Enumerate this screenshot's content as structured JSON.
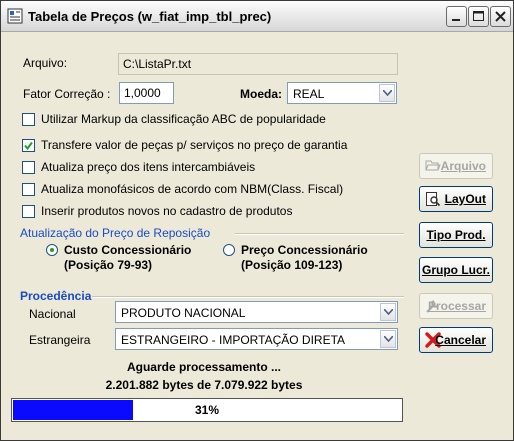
{
  "window": {
    "title": "Tabela de Preços (w_fiat_imp_tbl_prec)"
  },
  "form": {
    "arquivo_label": "Arquivo:",
    "arquivo_value": "C:\\ListaPr.txt",
    "fator_label": "Fator Correção :",
    "fator_value": "1,0000",
    "moeda_label": "Moeda:",
    "moeda_value": "REAL"
  },
  "options": [
    {
      "label": "Utilizar Markup da classificação ABC de popularidade",
      "checked": false
    },
    {
      "label": "Transfere valor de peças p/ serviços no preço de garantia",
      "checked": true
    },
    {
      "label": "Atualiza preço dos itens intercambiáveis",
      "checked": false
    },
    {
      "label": "Atualiza monofásicos de acordo com NBM(Class. Fiscal)",
      "checked": false
    },
    {
      "label": "Inserir produtos novos no cadastro de produtos",
      "checked": false
    }
  ],
  "reposicao": {
    "title": "Atualização do Preço de Reposição",
    "options": [
      {
        "label": "Custo Concessionário",
        "sub": "(Posição 79-93)",
        "selected": true
      },
      {
        "label": "Preço Concessionário",
        "sub": "(Posição 109-123)",
        "selected": false
      }
    ]
  },
  "procedencia": {
    "title": "Procedência",
    "nacional_label": "Nacional",
    "nacional_value": "PRODUTO NACIONAL",
    "estrangeira_label": "Estrangeira",
    "estrangeira_value": "ESTRANGEIRO - IMPORTAÇÃO DIRETA"
  },
  "buttons": {
    "arquivo": "Arquivo",
    "layout": "LayOut",
    "tipo_prod": "Tipo Prod.",
    "grupo_lucr": "Grupo Lucr.",
    "processar": "Processar",
    "cancelar": "Cancelar"
  },
  "status": {
    "message": "Aguarde processamento ...",
    "bytes": "2.201.882 bytes de 7.079.922 bytes",
    "progress_label": "31%",
    "progress_fraction": 0.31
  },
  "colors": {
    "progress_fill": "#0a0aff",
    "section_title": "#1a4bc4"
  }
}
